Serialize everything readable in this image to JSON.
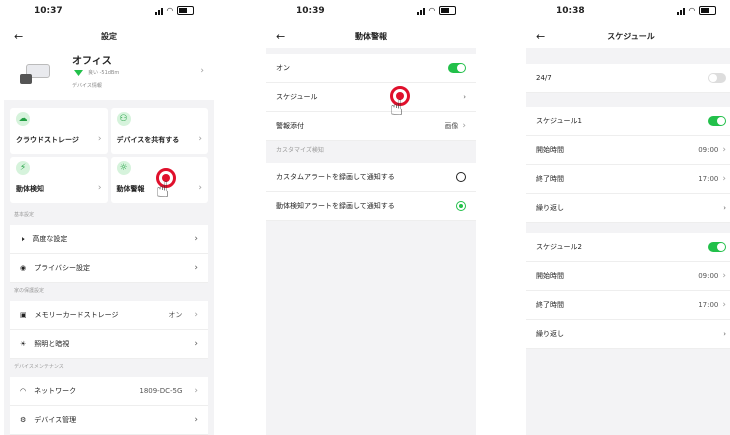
{
  "phone1": {
    "time": "10:37",
    "title": "設定",
    "device": {
      "name": "オフィス",
      "signal": "良い -51dBm",
      "info": "デバイス情報"
    },
    "tiles": [
      {
        "label": "クラウドストレージ",
        "icon": "cloud-icon"
      },
      {
        "label": "デバイスを共有する",
        "icon": "share-users-icon"
      },
      {
        "label": "動体検知",
        "icon": "motion-icon"
      },
      {
        "label": "動体警報",
        "icon": "alarm-icon"
      }
    ],
    "section_basic": "基本設定",
    "basic": [
      {
        "label": "高度な設定",
        "icon": "speaker-icon"
      },
      {
        "label": "プライバシー設定",
        "icon": "eye-off-icon"
      }
    ],
    "section_protect": "家の保護設定",
    "protect": [
      {
        "label": "メモリーカードストレージ",
        "value": "オン",
        "icon": "sd-card-icon"
      },
      {
        "label": "照明と暗視",
        "icon": "sun-icon"
      }
    ],
    "section_maint": "デバイスメンテナンス",
    "maint": [
      {
        "label": "ネットワーク",
        "value": "1809-DC-5G",
        "icon": "wifi-icon"
      },
      {
        "label": "デバイス管理",
        "icon": "device-manage-icon"
      }
    ]
  },
  "phone2": {
    "time": "10:39",
    "title": "動体警報",
    "rows": [
      {
        "label": "オン"
      },
      {
        "label": "スケジュール"
      },
      {
        "label": "警報添付",
        "value": "画像"
      }
    ],
    "section": "カスタマイズ検知",
    "options": [
      {
        "label": "カスタムアラートを録画して通知する"
      },
      {
        "label": "動体検知アラートを録画して通知する"
      }
    ]
  },
  "phone3": {
    "time": "10:38",
    "title": "スケジュール",
    "always": "24/7",
    "s1": {
      "name": "スケジュール1",
      "start_label": "開始時間",
      "start": "09:00",
      "end_label": "終了時間",
      "end": "17:00",
      "repeat": "繰り返し"
    },
    "s2": {
      "name": "スケジュール2",
      "start_label": "開始時間",
      "start": "09:00",
      "end_label": "終了時間",
      "end": "17:00",
      "repeat": "繰り返し"
    }
  },
  "colors": {
    "accent": "#22c04a",
    "tap": "#e0102c"
  }
}
